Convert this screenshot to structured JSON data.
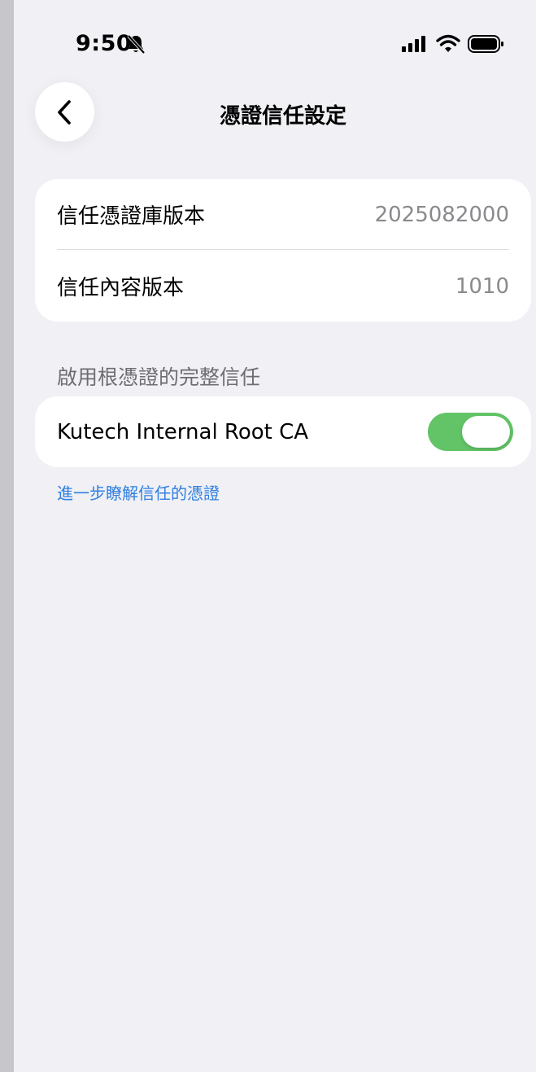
{
  "status_bar": {
    "time": "9:50",
    "icons": [
      "bell-slash-icon",
      "cellular-signal-icon",
      "wifi-icon",
      "battery-icon"
    ]
  },
  "nav": {
    "back_icon": "chevron-left-icon",
    "title": "憑證信任設定"
  },
  "versions": {
    "rows": [
      {
        "label": "信任憑證庫版本",
        "value": "2025082000"
      },
      {
        "label": "信任內容版本",
        "value": "1010"
      }
    ]
  },
  "root_trust": {
    "section_header": "啟用根憑證的完整信任",
    "certificate_name": "Kutech Internal Root CA",
    "enabled": true,
    "toggle_color": "#62c466"
  },
  "learn_more": {
    "link_text": "進一步瞭解信任的憑證",
    "link_color": "#2f7fe0"
  }
}
